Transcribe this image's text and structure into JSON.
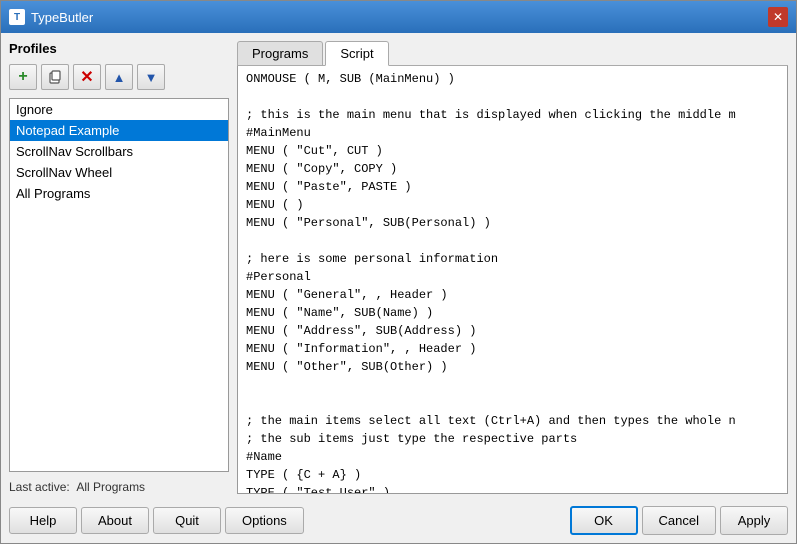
{
  "window": {
    "title": "TypeButler",
    "close_label": "✕"
  },
  "left_panel": {
    "title": "Profiles",
    "toolbar": [
      {
        "id": "add",
        "icon": "+",
        "color": "#2a8a2a",
        "label": "Add profile"
      },
      {
        "id": "copy",
        "icon": "❑",
        "color": "#555",
        "label": "Copy profile"
      },
      {
        "id": "delete",
        "icon": "✕",
        "color": "#cc0000",
        "label": "Delete profile"
      },
      {
        "id": "up",
        "icon": "▲",
        "color": "#2255aa",
        "label": "Move up"
      },
      {
        "id": "down",
        "icon": "▼",
        "color": "#2255aa",
        "label": "Move down"
      }
    ],
    "profiles": [
      {
        "name": "Ignore",
        "selected": false
      },
      {
        "name": "Notepad Example",
        "selected": true
      },
      {
        "name": "ScrollNav Scrollbars",
        "selected": false
      },
      {
        "name": "ScrollNav Wheel",
        "selected": false
      },
      {
        "name": "All Programs",
        "selected": false
      }
    ],
    "last_active_label": "Last active:",
    "last_active_value": "All Programs"
  },
  "right_panel": {
    "tabs": [
      {
        "id": "programs",
        "label": "Programs",
        "active": false
      },
      {
        "id": "script",
        "label": "Script",
        "active": true
      }
    ],
    "script_content": "ONMOUSE ( M, SUB (MainMenu) )\n\n; this is the main menu that is displayed when clicking the middle m\n#MainMenu\nMENU ( \"Cut\", CUT )\nMENU ( \"Copy\", COPY )\nMENU ( \"Paste\", PASTE )\nMENU ( )\nMENU ( \"Personal\", SUB(Personal) )\n\n; here is some personal information\n#Personal\nMENU ( \"General\", , Header )\nMENU ( \"Name\", SUB(Name) )\nMENU ( \"Address\", SUB(Address) )\nMENU ( \"Information\", , Header )\nMENU ( \"Other\", SUB(Other) )\n\n\n; the main items select all text (Ctrl+A) and then types the whole n\n; the sub items just type the respective parts\n#Name\nTYPE ( {C + A} )\nTYPE ( \"Test User\" )\nMENU ( \"First\", TYPE(\"Test\") )"
  },
  "bottom_buttons": {
    "help_label": "Help",
    "about_label": "About",
    "quit_label": "Quit",
    "options_label": "Options",
    "ok_label": "OK",
    "cancel_label": "Cancel",
    "apply_label": "Apply"
  }
}
